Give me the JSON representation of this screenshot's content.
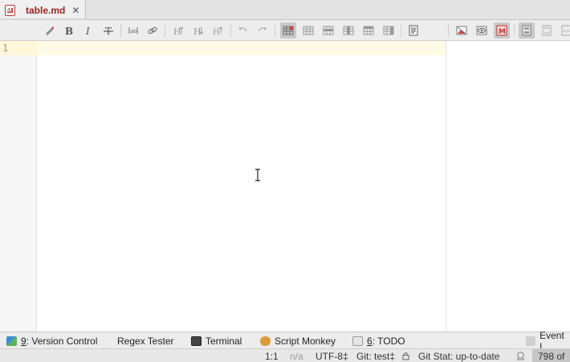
{
  "tabs": [
    {
      "label": "table.md",
      "icon": "markdown-file-icon",
      "close": "✕"
    }
  ],
  "toolbar": {
    "items": [
      "pencil-icon",
      "bold-icon",
      "italic-icon",
      "strikethrough-icon",
      "code-icon",
      "link-icon",
      "header-up-icon",
      "header-down-icon",
      "header-toggle-icon",
      "undo-icon",
      "redo-icon",
      "insert-table-icon",
      "table-icon",
      "insert-row-above-icon",
      "insert-column-icon",
      "delete-row-icon",
      "delete-column-icon",
      "document-icon",
      "image-icon",
      "preview-icon",
      "markdown-icon",
      "layout-split-icon",
      "layout-preview-icon",
      "layout-source-icon"
    ],
    "active": [
      "insert-table-icon",
      "markdown-icon",
      "layout-split-icon"
    ]
  },
  "editor": {
    "line_numbers": [
      "1"
    ]
  },
  "tool_windows": [
    {
      "key": "9",
      "label": ": Version Control",
      "icon": "version-control-icon"
    },
    {
      "key": "",
      "label": "Regex Tester",
      "icon": ""
    },
    {
      "key": "",
      "label": "Terminal",
      "icon": "terminal-icon"
    },
    {
      "key": "",
      "label": "Script Monkey",
      "icon": "monkey-icon"
    },
    {
      "key": "6",
      "label": ": TODO",
      "icon": "todo-icon"
    },
    {
      "key": "",
      "label": "Event L",
      "icon": "event-log-icon"
    }
  ],
  "status": {
    "position": "1:1",
    "na": "n/a",
    "encoding": "UTF-8‡",
    "git_branch": "Git: test‡",
    "git_stat": "Git Stat: up-to-date",
    "memory": "798 of"
  },
  "colors": {
    "tab_text": "#a02020",
    "current_line": "#fffbe6",
    "active_button": "#c9c9c9"
  }
}
